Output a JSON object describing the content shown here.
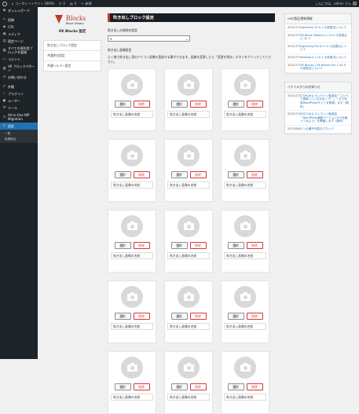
{
  "admin_bar": {
    "site_name": "コーポレートサイト DEMO",
    "updates": "0",
    "comments": "0",
    "new_label": "新規",
    "greeting": "こんにちは、admin さん"
  },
  "sidebar": {
    "items": [
      {
        "label": "ダッシュボード",
        "icon": "dashboard-icon"
      },
      {
        "label": "投稿",
        "icon": "pin-icon"
      },
      {
        "label": "CTA",
        "icon": "megaphone-icon"
      },
      {
        "label": "メディア",
        "icon": "media-icon"
      },
      {
        "label": "固定ページ",
        "icon": "page-icon"
      },
      {
        "label": "すべての再利用ブロックを管理",
        "icon": "block-icon"
      },
      {
        "label": "コメント",
        "icon": "comment-icon"
      },
      {
        "label": "VK ブロックパターン",
        "icon": "pattern-icon"
      },
      {
        "label": "お問い合わせ",
        "icon": "mail-icon"
      },
      {
        "label": "外観",
        "icon": "brush-icon"
      },
      {
        "label": "プラグイン",
        "icon": "plugin-icon"
      },
      {
        "label": "ユーザー",
        "icon": "user-icon"
      },
      {
        "label": "ツール",
        "icon": "wrench-icon"
      },
      {
        "label": "All-in-One WP Migration",
        "icon": "migration-icon"
      },
      {
        "label": "設定",
        "icon": "settings-icon"
      }
    ],
    "submenu": [
      "一般",
      "投稿設定"
    ]
  },
  "settings_nav": {
    "logo_main": "Blocks",
    "logo_sub": "Block Library",
    "logo_prefix": "VK",
    "title": "VK Blocks 設定",
    "items": [
      "吹き出しブロック設定",
      "共通余白設定",
      "共通ヘルパー設定"
    ]
  },
  "main": {
    "section_title": "吹き出しブロック設定",
    "display_label": "吹き出しの現地の設定",
    "select_value": "5",
    "images_label": "吹き出し画像設定",
    "description": "よく使う吹き出し用のアイコン画像を登録する事ができます。画像を変更したら「変更を保存」ボタンをクリックしてください。",
    "select_button": "選択",
    "delete_button": "削除",
    "name_placeholder": "吹き出し画像の名前"
  },
  "cards": [
    1,
    2,
    3,
    4,
    5,
    6,
    7,
    8,
    9,
    10,
    11,
    12,
    13,
    14,
    15
  ],
  "aside": {
    "panel1_title": "VKの製品更新情報",
    "news1": [
      {
        "date": "2022/7/7",
        "title": "Lightning 15.0.1 の変更点について"
      },
      {
        "date": "2022/7/7",
        "title": "VK Block Patterns 1.25.0 の変更点について"
      },
      {
        "date": "2022/7/7",
        "title": "Lightning Pro 8.17.4 の変更点について"
      },
      {
        "date": "2022/7/7",
        "title": "Katawara 1.10.1 の変更点について"
      },
      {
        "date": "2022/7/7",
        "title": "VK Blocks / VK Blocks Pro 1.35.0 の変更点について"
      }
    ],
    "panel2_title": "ベクトルからのお知らせ",
    "news2": [
      {
        "date": "2022/7/7",
        "title": "[7/26(木)] オンライン勉強会「ゴジベで簡単 | ○○の方法ノブ！」ーズで作成WordPressサイトを簡単」ます（無料）"
      },
      {
        "date": "2022/7/7",
        "title": "[6/27(木)] オンライン勉強会「WordPress最新バージョン6.0を触ってみよう」を開催します（無料）"
      },
      {
        "date": "2022/6/6",
        "title": "ランの補不可能なブロック"
      }
    ]
  }
}
